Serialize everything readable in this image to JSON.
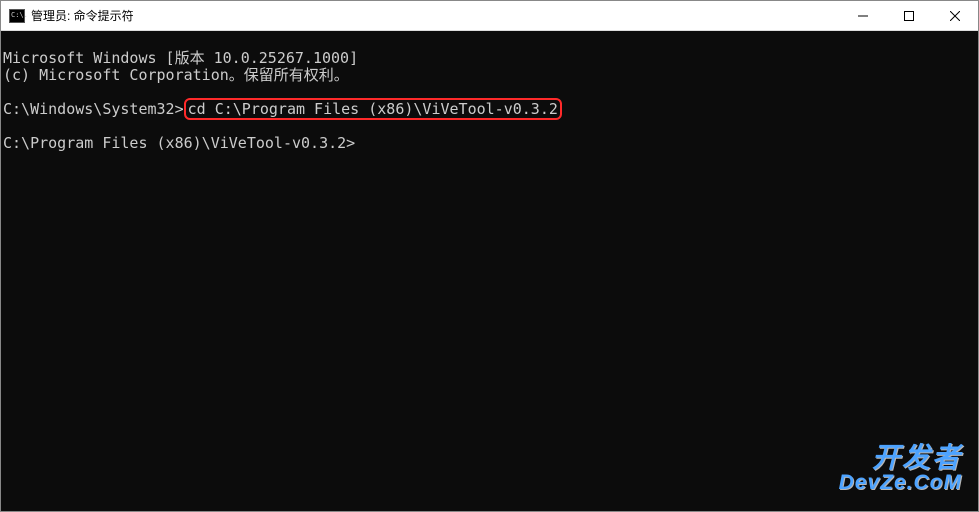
{
  "titlebar": {
    "icon_label": "C:\\.",
    "title": "管理员: 命令提示符"
  },
  "controls": {
    "minimize": "minimize",
    "maximize": "maximize",
    "close": "close"
  },
  "terminal": {
    "line1": "Microsoft Windows [版本 10.0.25267.1000]",
    "line2": "(c) Microsoft Corporation。保留所有权利。",
    "blank1": "",
    "prompt1_prefix": "C:\\Windows\\System32>",
    "prompt1_command": "cd C:\\Program Files (x86)\\ViVeTool-v0.3.2",
    "blank2": "",
    "prompt2": "C:\\Program Files (x86)\\ViVeTool-v0.3.2>"
  },
  "watermark": {
    "line1": "开发者",
    "line2": "DevZe.CoM"
  }
}
